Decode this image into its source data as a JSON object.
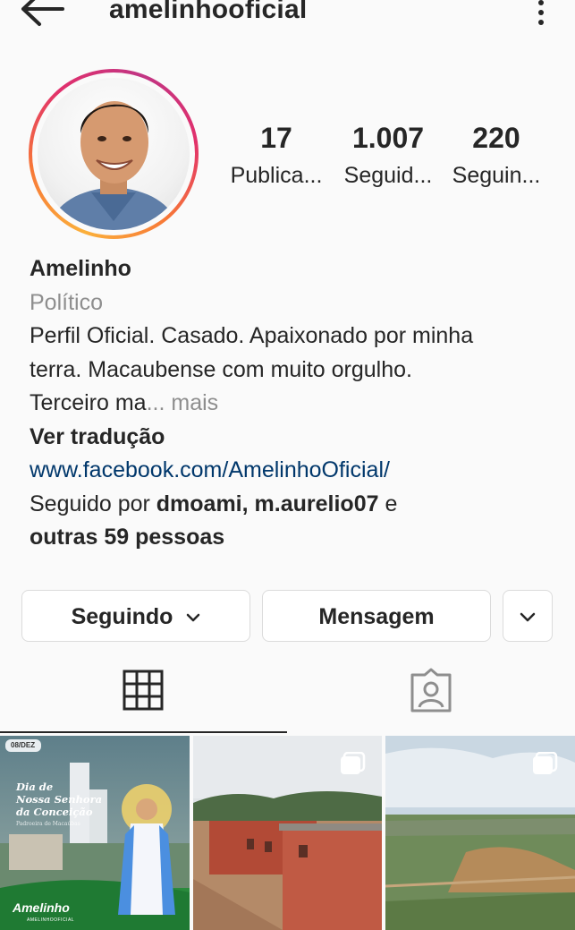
{
  "header": {
    "username": "amelinhooficial",
    "back_icon": "arrow-left-icon",
    "more_icon": "more-vertical-icon"
  },
  "profile": {
    "avatar_icon": "profile-photo",
    "stats": [
      {
        "value": "17",
        "label": "Publica..."
      },
      {
        "value": "1.007",
        "label": "Seguid..."
      },
      {
        "value": "220",
        "label": "Seguin..."
      }
    ],
    "name": "Amelinho",
    "category": "Político",
    "bio_line1": "Perfil Oficial. Casado. Apaixonado por minha",
    "bio_line2": "terra. Macaubense com muito orgulho.",
    "bio_line3": "Terceiro ma",
    "bio_more": "... mais",
    "translate": "Ver tradução",
    "link": "www.facebook.com/AmelinhoOficial/",
    "followed_by_prefix": "Seguido por ",
    "followed_by_user1": "dmoami",
    "followed_by_sep": ", ",
    "followed_by_user2": "m.aurelio07",
    "followed_by_and": " e",
    "followed_by_others": "outras 59 pessoas"
  },
  "actions": {
    "following_label": "Seguindo",
    "message_label": "Mensagem"
  },
  "tabs": [
    {
      "icon": "grid-icon",
      "active": true
    },
    {
      "icon": "tagged-icon",
      "active": false
    }
  ],
  "posts": [
    {
      "date_badge": "08/DEZ",
      "title_line1": "Dia de",
      "title_line2": "Nossa Senhora",
      "title_line3": "da Conceição",
      "subtitle": "Padroeira de Macaúbas",
      "brand": "Amelinho",
      "handle": "AMELINHOOFICIAL"
    },
    {
      "multi": true
    },
    {
      "multi": true
    }
  ],
  "colors": {
    "link": "#00376b",
    "muted": "#8e8e8e",
    "ring_start": "#fbb03b",
    "ring_end": "#c13584"
  }
}
